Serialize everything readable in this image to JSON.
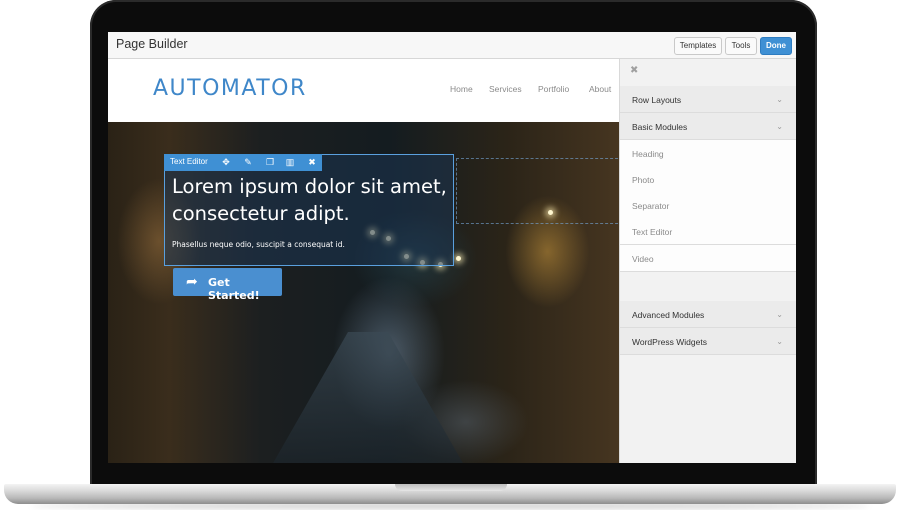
{
  "builder": {
    "title": "Page Builder",
    "buttons": {
      "templates": "Templates",
      "tools": "Tools",
      "done": "Done"
    }
  },
  "site": {
    "logo": "AUTOMATOR",
    "nav": [
      "Home",
      "Services",
      "Portfolio",
      "About"
    ]
  },
  "editor": {
    "toolbar_label": "Text Editor",
    "tools": [
      "move-icon",
      "wrench-icon",
      "duplicate-icon",
      "columns-icon",
      "close-icon"
    ]
  },
  "hero": {
    "headline_line1": "Lorem ipsum dolor sit amet,",
    "headline_line2": "consectetur adipt.",
    "subline": "Phasellus neque odio, suscipit a consequat id.",
    "cta_label": "Get Started!"
  },
  "panel": {
    "sections": {
      "row_layouts": "Row Layouts",
      "basic_modules": "Basic Modules",
      "advanced_modules": "Advanced Modules",
      "wordpress_widgets": "WordPress Widgets"
    },
    "basic_items": [
      "Heading",
      "Photo",
      "Separator",
      "Text Editor",
      "Video"
    ]
  },
  "colors": {
    "accent": "#3f90d4",
    "logo": "#3f87c9"
  }
}
